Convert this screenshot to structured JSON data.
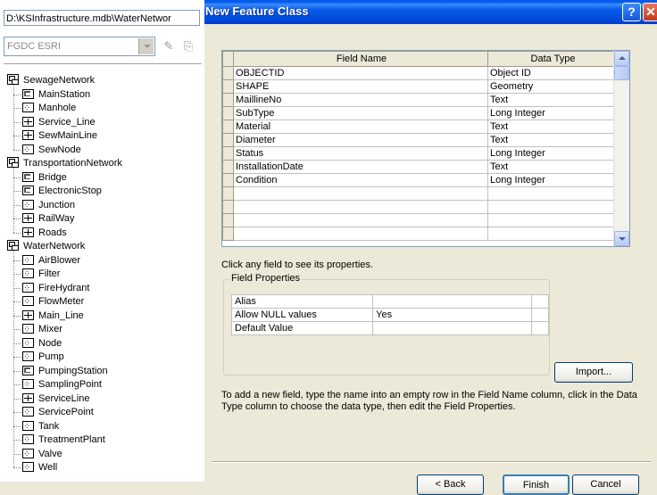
{
  "catalog": {
    "path": "D:\\KSInfrastructure.mdb\\WaterNetwor",
    "metadata_style": "FGDC ESRI",
    "tree": [
      {
        "label": "SewageNetwork",
        "type": "dataset",
        "children": [
          {
            "label": "MainStation",
            "icon": "polygon"
          },
          {
            "label": "Manhole",
            "icon": "point"
          },
          {
            "label": "Service_Line",
            "icon": "line"
          },
          {
            "label": "SewMainLine",
            "icon": "line"
          },
          {
            "label": "SewNode",
            "icon": "point"
          }
        ]
      },
      {
        "label": "TransportationNetwork",
        "type": "dataset",
        "children": [
          {
            "label": "Bridge",
            "icon": "polygon"
          },
          {
            "label": "ElectronicStop",
            "icon": "polygon"
          },
          {
            "label": "Junction",
            "icon": "point"
          },
          {
            "label": "RailWay",
            "icon": "line"
          },
          {
            "label": "Roads",
            "icon": "line"
          }
        ]
      },
      {
        "label": "WaterNetwork",
        "type": "dataset",
        "children": [
          {
            "label": "AirBlower",
            "icon": "point"
          },
          {
            "label": "Filter",
            "icon": "point"
          },
          {
            "label": "FireHydrant",
            "icon": "point"
          },
          {
            "label": "FlowMeter",
            "icon": "point"
          },
          {
            "label": "Main_Line",
            "icon": "line"
          },
          {
            "label": "Mixer",
            "icon": "point"
          },
          {
            "label": "Node",
            "icon": "point"
          },
          {
            "label": "Pump",
            "icon": "point"
          },
          {
            "label": "PumpingStation",
            "icon": "polygon"
          },
          {
            "label": "SamplingPoint",
            "icon": "point"
          },
          {
            "label": "ServiceLine",
            "icon": "line"
          },
          {
            "label": "ServicePoint",
            "icon": "point"
          },
          {
            "label": "Tank",
            "icon": "point"
          },
          {
            "label": "TreatmentPlant",
            "icon": "point"
          },
          {
            "label": "Valve",
            "icon": "point"
          },
          {
            "label": "Well",
            "icon": "point"
          }
        ]
      }
    ]
  },
  "dialog": {
    "title": "New Feature Class",
    "help_glyph": "?",
    "close_glyph": "✕",
    "grid": {
      "headers": [
        "Field Name",
        "Data Type"
      ],
      "rows": [
        [
          "OBJECTID",
          "Object ID"
        ],
        [
          "SHAPE",
          "Geometry"
        ],
        [
          "MaillineNo",
          "Text"
        ],
        [
          "SubType",
          "Long Integer"
        ],
        [
          "Material",
          "Text"
        ],
        [
          "Diameter",
          "Text"
        ],
        [
          "Status",
          "Long Integer"
        ],
        [
          "InstallationDate",
          "Text"
        ],
        [
          "Condition",
          "Long Integer"
        ],
        [
          "",
          ""
        ],
        [
          "",
          ""
        ],
        [
          "",
          ""
        ],
        [
          "",
          ""
        ]
      ]
    },
    "hint": "Click any field to see its properties.",
    "field_properties": {
      "legend": "Field Properties",
      "rows": [
        [
          "Alias",
          ""
        ],
        [
          "Allow NULL values",
          "Yes"
        ],
        [
          "Default Value",
          ""
        ]
      ]
    },
    "import_label": "Import...",
    "help_text": "To add a new field, type the name into an empty row in the Field Name column, click in the Data Type column to choose the data type, then edit the Field Properties.",
    "buttons": {
      "back": "< Back",
      "finish": "Finish",
      "cancel": "Cancel"
    }
  }
}
